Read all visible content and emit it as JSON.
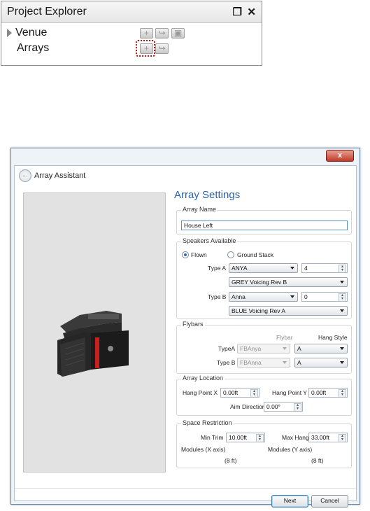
{
  "project_explorer": {
    "title": "Project Explorer",
    "pin_icon": "restore-window-icon",
    "close_icon": "close-icon",
    "tree": [
      {
        "label": "Venue",
        "expander": "expand-triangle-icon"
      },
      {
        "label": "Arrays"
      }
    ],
    "highlight_color": "#c01010"
  },
  "dialog": {
    "title": "Array Assistant",
    "close_glyph": "x",
    "section_title": "Array Settings",
    "array_name": {
      "legend": "Array Name",
      "value": "House Left"
    },
    "speakers": {
      "legend": "Speakers Available",
      "option_flown": "Flown",
      "option_ground": "Ground Stack",
      "selected": "Flown",
      "type_a_label": "Type A",
      "type_a_model": "ANYA",
      "type_a_count": "4",
      "type_a_voicing": "GREY Voicing Rev B",
      "type_b_label": "Type B",
      "type_b_model": "Anna",
      "type_b_count": "0",
      "type_b_voicing": "BLUE Voicing Rev A"
    },
    "flybars": {
      "legend": "Flybars",
      "col_flybar": "Flybar",
      "col_hang": "Hang Style",
      "type_a_label": "TypeA",
      "type_a_flybar": "FBAnya",
      "type_a_hang": "A",
      "type_b_label": "Type B",
      "type_b_flybar": "FBAnna",
      "type_b_hang": "A"
    },
    "location": {
      "legend": "Array Location",
      "hang_x_label": "Hang Point X",
      "hang_x": "0.00ft",
      "hang_y_label": "Hang Point Y",
      "hang_y": "0.00ft",
      "aim_label": "Aim Direction",
      "aim": "0.00°"
    },
    "space": {
      "legend": "Space Restriction",
      "min_trim_label": "Min Trim",
      "min_trim": "10.00ft",
      "max_hang_label": "Max Hang",
      "max_hang": "33.00ft",
      "modules_x_label": "Modules (X axis)",
      "modules_x": "(8 ft)",
      "modules_y_label": "Modules (Y axis)",
      "modules_y": "(8 ft)"
    },
    "next_label": "Next",
    "cancel_label": "Cancel",
    "accent_color": "#2a63a8"
  }
}
